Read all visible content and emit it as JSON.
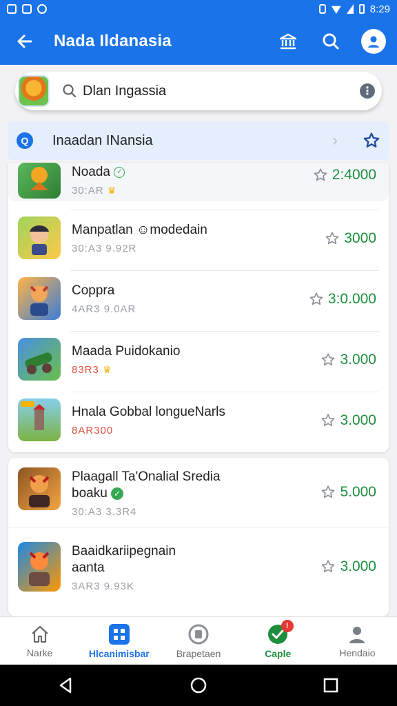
{
  "status_bar": {
    "time": "8:29"
  },
  "app_bar": {
    "title": "Nada Ildanasia"
  },
  "search": {
    "query": "Dlan Ingassia"
  },
  "banner": {
    "text": "Inaadan INansia"
  },
  "apps": [
    {
      "name": "Noada",
      "meta": "30:AR",
      "price": "2:4000"
    },
    {
      "name": "Manpatlan ☺modedain",
      "meta": "30:A3 9.92R",
      "price": "3000"
    },
    {
      "name": "Coppra",
      "meta": "4AR3 9.0AR",
      "price": "3:0.000"
    },
    {
      "name": "Maada  Puidokanio",
      "meta": "83R3",
      "price": "3.000"
    },
    {
      "name": "Hnala Gobbal longueNarls",
      "meta": "8AR300",
      "price": "3.000"
    },
    {
      "name": "Plaagall Ta'Onalial Sredia\nboaku",
      "meta": "30:A3 3.3R4",
      "price": "5.000"
    },
    {
      "name": "Baaidkariipegnain\naanta",
      "meta": "3AR3 9.93K",
      "price": "3.000"
    }
  ],
  "bottom_nav": [
    {
      "label": "Narke"
    },
    {
      "label": "Hlcanimisbar"
    },
    {
      "label": "Brapetaen"
    },
    {
      "label": "Caple",
      "badge": "!"
    },
    {
      "label": "Hendaio"
    }
  ],
  "colors": {
    "primary": "#1a73e8",
    "price_green": "#1e8e3e"
  }
}
